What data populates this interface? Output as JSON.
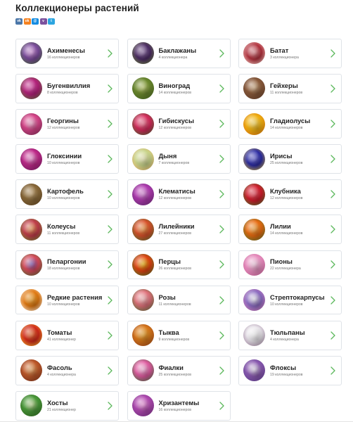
{
  "page": {
    "title": "Коллекционеры растений"
  },
  "share_buttons": [
    {
      "name": "vk-share-icon",
      "glyph": "vk",
      "color": "#4a76a8"
    },
    {
      "name": "odnoklassniki-share-icon",
      "glyph": "ok",
      "color": "#f58220"
    },
    {
      "name": "moimir-share-icon",
      "glyph": "@",
      "color": "#168de2"
    },
    {
      "name": "viber-share-icon",
      "glyph": "v",
      "color": "#7b519d"
    },
    {
      "name": "telegram-share-icon",
      "glyph": "t",
      "color": "#2ca5e0"
    }
  ],
  "accent_color": "#5cb85c",
  "categories": [
    {
      "label": "Ахименесы",
      "count": "16 коллекционеров",
      "c1": "#7a4a9c",
      "c2": "#e0a6e8",
      "c3": "#3d6b2a"
    },
    {
      "label": "Баклажаны",
      "count": "4 коллекционера",
      "c1": "#4b2a63",
      "c2": "#9a7bb0",
      "c3": "#6e8f3a"
    },
    {
      "label": "Батат",
      "count": "3 коллекционера",
      "c1": "#b0303c",
      "c2": "#e89ba0",
      "c3": "#f3e0d4"
    },
    {
      "label": "Бугенвиллия",
      "count": "8 коллекционеров",
      "c1": "#b3207a",
      "c2": "#e45bb3",
      "c3": "#4a7b2c"
    },
    {
      "label": "Виноград",
      "count": "14 коллекционеров",
      "c1": "#6d8a2e",
      "c2": "#c5d47a",
      "c3": "#3c5a1e"
    },
    {
      "label": "Гейхеры",
      "count": "11 коллекционеров",
      "c1": "#8a5a3a",
      "c2": "#d7b58f",
      "c3": "#5a3a2a"
    },
    {
      "label": "Георгины",
      "count": "12 коллекционеров",
      "c1": "#d8458a",
      "c2": "#f0b0d0",
      "c3": "#6a2a4a"
    },
    {
      "label": "Гибискусы",
      "count": "12 коллекционеров",
      "c1": "#d4285a",
      "c2": "#f2829a",
      "c3": "#2f6a2a"
    },
    {
      "label": "Гладиолусы",
      "count": "14 коллекционеров",
      "c1": "#f0b010",
      "c2": "#fce070",
      "c3": "#d06810"
    },
    {
      "label": "Глоксинии",
      "count": "10 коллекционеров",
      "c1": "#c02a8a",
      "c2": "#f0a0d8",
      "c3": "#6a1a5a"
    },
    {
      "label": "Дыня",
      "count": "7 коллекционеров",
      "c1": "#c8d48a",
      "c2": "#f2f0c0",
      "c3": "#e0a860"
    },
    {
      "label": "Ирисы",
      "count": "25 коллекционеров",
      "c1": "#2a2aa0",
      "c2": "#7a7ae0",
      "c3": "#e0c030"
    },
    {
      "label": "Картофель",
      "count": "10 коллекционеров",
      "c1": "#8a6a3a",
      "c2": "#d0b080",
      "c3": "#5a4020"
    },
    {
      "label": "Клематисы",
      "count": "12 коллекционеров",
      "c1": "#b03ab0",
      "c2": "#e09ae0",
      "c3": "#5a2a6a"
    },
    {
      "label": "Клубника",
      "count": "12 коллекционеров",
      "c1": "#d01a2a",
      "c2": "#f06070",
      "c3": "#2a7a2a"
    },
    {
      "label": "Колеусы",
      "count": "11 коллекционеров",
      "c1": "#c03a4a",
      "c2": "#f0a060",
      "c3": "#5a8a2a"
    },
    {
      "label": "Лилейники",
      "count": "27 коллекционеров",
      "c1": "#d8502a",
      "c2": "#f0a050",
      "c3": "#3a6a2a"
    },
    {
      "label": "Лилии",
      "count": "14 коллекционеров",
      "c1": "#e86a10",
      "c2": "#f8b050",
      "c3": "#3a6a2a"
    },
    {
      "label": "Пеларгонии",
      "count": "18 коллекционеров",
      "c1": "#d84a5a",
      "c2": "#8a6ac0",
      "c3": "#3a6a2a"
    },
    {
      "label": "Перцы",
      "count": "26 коллекционеров",
      "c1": "#e04010",
      "c2": "#f0c020",
      "c3": "#2a7a2a"
    },
    {
      "label": "Пионы",
      "count": "22 коллекционера",
      "c1": "#e890c0",
      "c2": "#fad8ea",
      "c3": "#c05a90"
    },
    {
      "label": "Редкие растения",
      "count": "10 коллекционеров",
      "c1": "#e07810",
      "c2": "#f8b040",
      "c3": "#f0f0f0"
    },
    {
      "label": "Розы",
      "count": "11 коллекционеров",
      "c1": "#e0707a",
      "c2": "#f8c0c0",
      "c3": "#3a6a2a"
    },
    {
      "label": "Стрептокарпусы",
      "count": "10 коллекционеров",
      "c1": "#8a6ac0",
      "c2": "#f0eef8",
      "c3": "#d07ab0"
    },
    {
      "label": "Томаты",
      "count": "41 коллекционер",
      "c1": "#d0281a",
      "c2": "#f07a40",
      "c3": "#e8c030"
    },
    {
      "label": "Тыква",
      "count": "9 коллекционеров",
      "c1": "#d8781a",
      "c2": "#f0b040",
      "c3": "#8a3a1a"
    },
    {
      "label": "Тюльпаны",
      "count": "4 коллекционера",
      "c1": "#e8e4ea",
      "c2": "#ffffff",
      "c3": "#8a6a8a"
    },
    {
      "label": "Фасоль",
      "count": "4 коллекционера",
      "c1": "#c05a2a",
      "c2": "#f0b070",
      "c3": "#6a2a1a"
    },
    {
      "label": "Фиалки",
      "count": "25 коллекционеров",
      "c1": "#e05aa0",
      "c2": "#f8c0e0",
      "c3": "#2a6a2a"
    },
    {
      "label": "Флоксы",
      "count": "19 коллекционеров",
      "c1": "#8a5ab0",
      "c2": "#e8e0f0",
      "c3": "#5a3a8a"
    },
    {
      "label": "Хосты",
      "count": "21 коллекционер",
      "c1": "#4a9a3a",
      "c2": "#c8e0a0",
      "c3": "#2a5a1a"
    },
    {
      "label": "Хризантемы",
      "count": "16 коллекционеров",
      "c1": "#b04ab0",
      "c2": "#f0a0e0",
      "c3": "#6a2a7a"
    }
  ]
}
